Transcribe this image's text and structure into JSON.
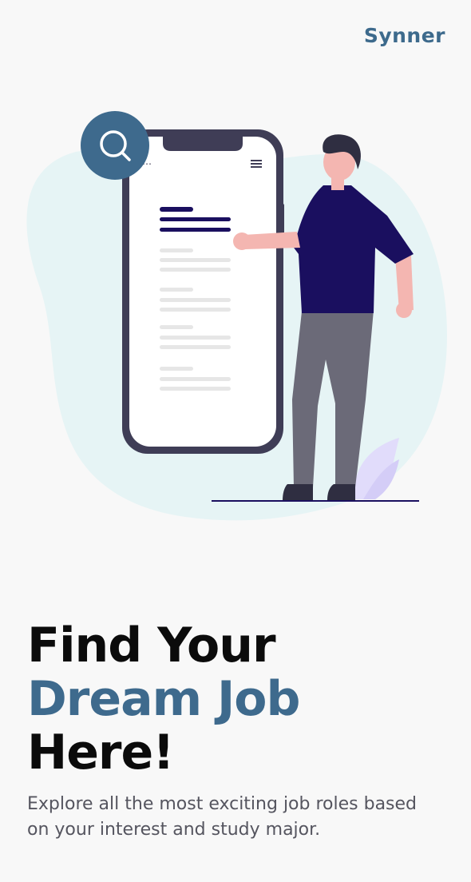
{
  "brand": {
    "name": "Synner"
  },
  "hero": {
    "headline_line1": "Find Your",
    "headline_line2": "Dream Job",
    "headline_line3": "Here!",
    "subtitle": "Explore all the most exciting job roles based on your interest and study major."
  },
  "colors": {
    "background": "#f8f8f8",
    "brand": "#3d6a8c",
    "accent": "#3e6a8d",
    "headline": "#0b0b0b",
    "subtitle": "#55555f",
    "blob": "#e6f4f5",
    "phone_frame": "#3f3d56",
    "shirt": "#1a0f5f",
    "pants": "#6b6a78",
    "skin": "#f4b6b1",
    "hair": "#2f2e41",
    "plant": "#e1dcfb"
  },
  "icons": {
    "search_bubble": "search-icon",
    "phone_menu": "hamburger-menu-icon"
  }
}
